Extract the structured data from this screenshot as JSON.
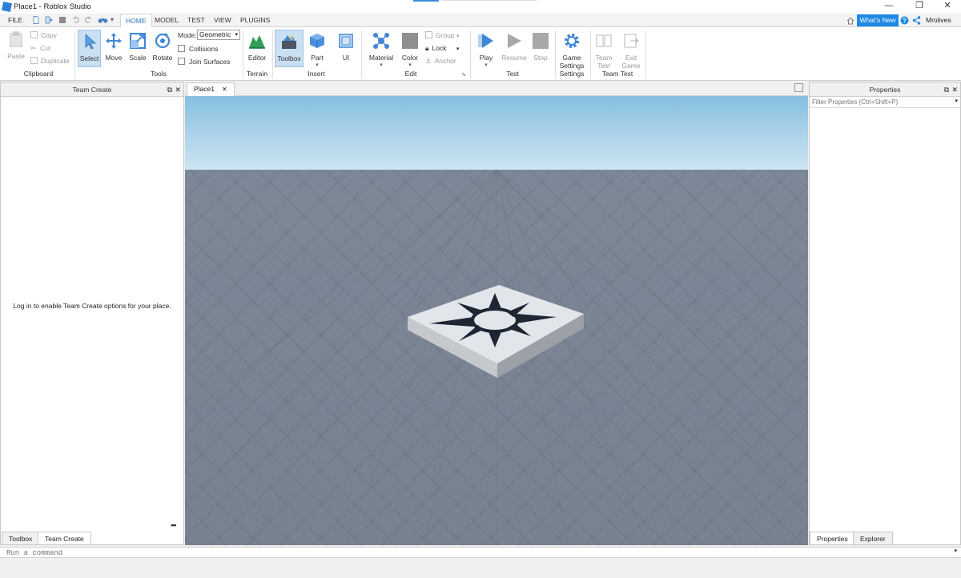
{
  "window": {
    "title": "Place1 - Roblox Studio"
  },
  "menu": {
    "file": "FILE",
    "tabs": [
      "HOME",
      "MODEL",
      "TEST",
      "VIEW",
      "PLUGINS"
    ],
    "whats_new": "What's New",
    "user": "Mrolives"
  },
  "ribbon": {
    "clipboard": {
      "paste": "Paste",
      "copy": "Copy",
      "cut": "Cut",
      "duplicate": "Duplicate",
      "label": "Clipboard"
    },
    "tools": {
      "select": "Select",
      "move": "Move",
      "scale": "Scale",
      "rotate": "Rotate",
      "mode_label": "Mode:",
      "mode_value": "Geometric",
      "collisions": "Collisions",
      "join_surfaces": "Join Surfaces",
      "label": "Tools"
    },
    "terrain": {
      "editor": "Editor",
      "label": "Terrain"
    },
    "insert": {
      "toolbox": "Toolbox",
      "part": "Part",
      "ui": "UI",
      "label": "Insert"
    },
    "edit": {
      "material": "Material",
      "color": "Color",
      "group": "Group",
      "lock": "Lock",
      "anchor": "Anchor",
      "label": "Edit"
    },
    "test": {
      "play": "Play",
      "resume": "Resume",
      "stop": "Stop",
      "label": "Test"
    },
    "settings": {
      "game_settings_line1": "Game",
      "game_settings_line2": "Settings",
      "label": "Settings"
    },
    "team_test": {
      "team_test_line1": "Team",
      "team_test_line2": "Test",
      "exit_game_line1": "Exit",
      "exit_game_line2": "Game",
      "label": "Team Test"
    }
  },
  "left_panel": {
    "title": "Team Create",
    "message": "Log in to enable Team Create options for your place.",
    "tabs": [
      "Toolbox",
      "Team Create"
    ]
  },
  "viewport": {
    "tab": "Place1"
  },
  "right_panel": {
    "title": "Properties",
    "filter_placeholder": "Filter Properties (Ctrl+Shift+P)",
    "tabs": [
      "Properties",
      "Explorer"
    ]
  },
  "command_bar": {
    "placeholder": "Run a command"
  },
  "colors": {
    "accent": "#1e88e5",
    "select_bg": "#c9dff2",
    "sky_top": "#8fc3e3",
    "baseplate": "#6b7484"
  }
}
